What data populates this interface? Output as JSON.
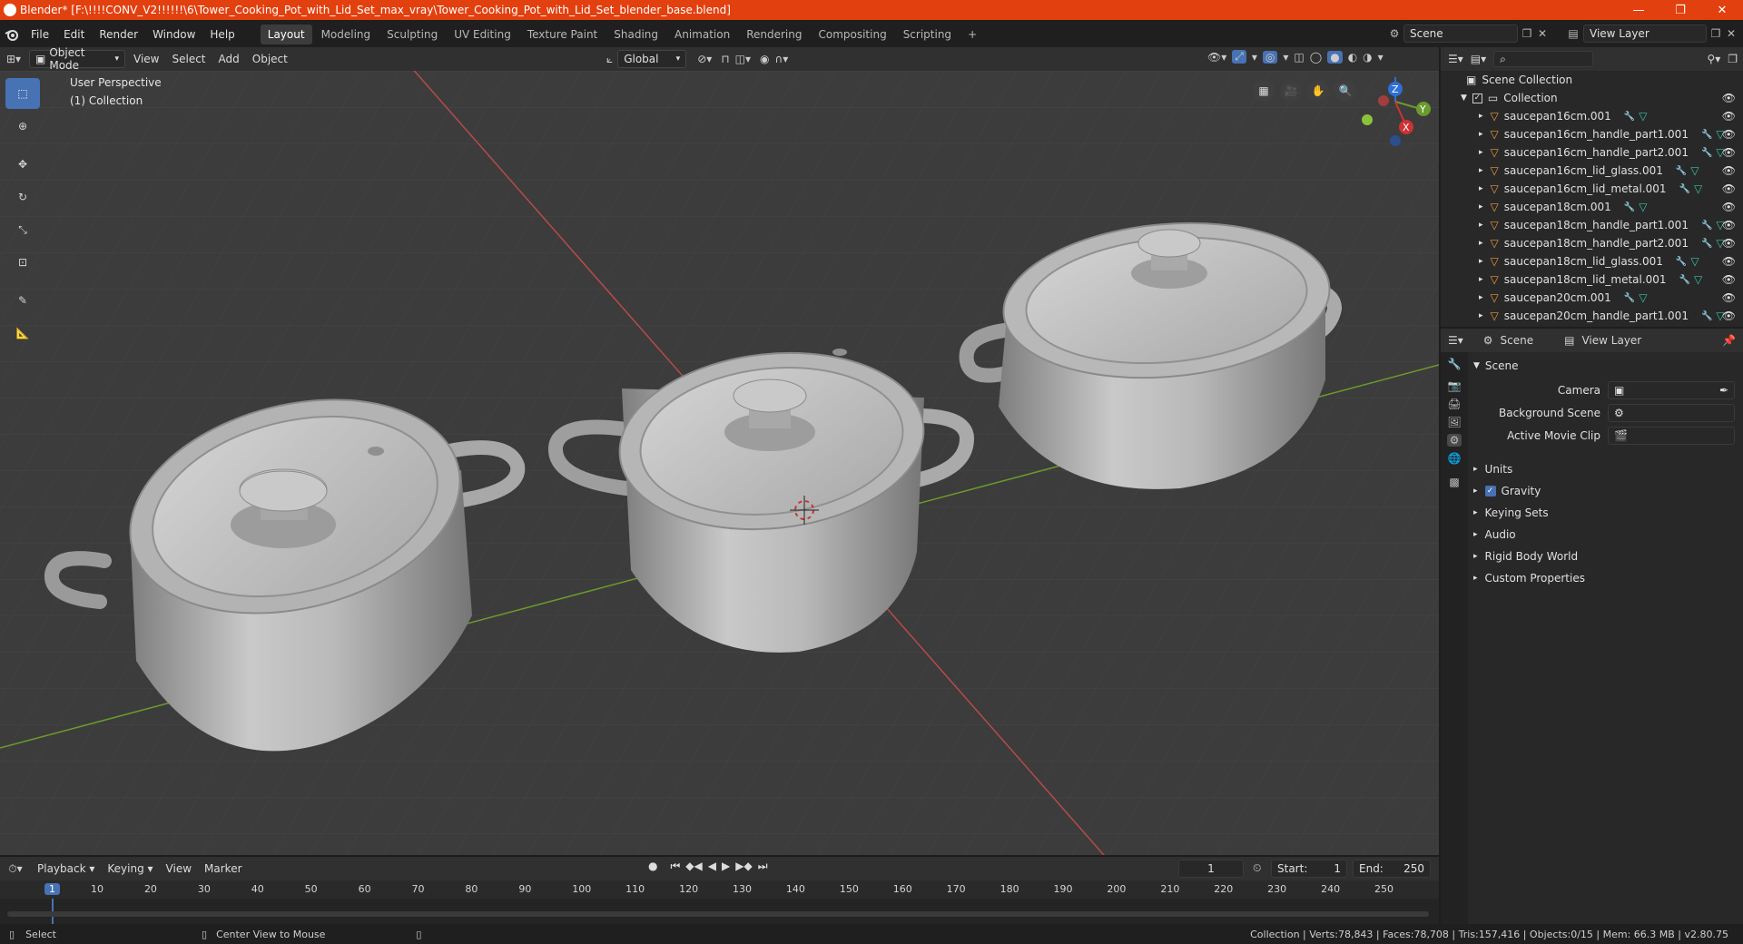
{
  "window": {
    "title": "Blender* [F:\\!!!!CONV_V2!!!!!!\\6\\Tower_Cooking_Pot_with_Lid_Set_max_vray\\Tower_Cooking_Pot_with_Lid_Set_blender_base.blend]",
    "controls": [
      "—",
      "❐",
      "✕"
    ]
  },
  "menubar": {
    "menus": [
      "File",
      "Edit",
      "Render",
      "Window",
      "Help"
    ],
    "workspaces": [
      "Layout",
      "Modeling",
      "Sculpting",
      "UV Editing",
      "Texture Paint",
      "Shading",
      "Animation",
      "Rendering",
      "Compositing",
      "Scripting"
    ],
    "active_workspace": "Layout",
    "add_workspace": "+",
    "scene_name": "Scene",
    "view_layer": "View Layer"
  },
  "viewport_header": {
    "mode": "Object Mode",
    "menus": [
      "View",
      "Select",
      "Add",
      "Object"
    ],
    "transform_orientation": "Global"
  },
  "viewport": {
    "perspective_label": "User Perspective",
    "collection_label": "(1) Collection",
    "gizmo_axes": {
      "x": "X",
      "y": "Y",
      "z": "Z"
    },
    "colors": {
      "background": "#3c3c3c",
      "grid": "#454545",
      "x_axis": "#b84a4a",
      "y_axis": "#6b9a2e",
      "accent": "#4772b3"
    }
  },
  "outliner": {
    "search_placeholder": "",
    "root": "Scene Collection",
    "collection": "Collection",
    "items": [
      "saucepan16cm.001",
      "saucepan16cm_handle_part1.001",
      "saucepan16cm_handle_part2.001",
      "saucepan16cm_lid_glass.001",
      "saucepan16cm_lid_metal.001",
      "saucepan18cm.001",
      "saucepan18cm_handle_part1.001",
      "saucepan18cm_handle_part2.001",
      "saucepan18cm_lid_glass.001",
      "saucepan18cm_lid_metal.001",
      "saucepan20cm.001",
      "saucepan20cm_handle_part1.001"
    ]
  },
  "properties": {
    "breadcrumb_scene": "Scene",
    "breadcrumb_view_layer": "View Layer",
    "panel_title": "Scene",
    "camera_label": "Camera",
    "background_scene_label": "Background Scene",
    "active_movie_clip_label": "Active Movie Clip",
    "subpanels": [
      "Units",
      "Gravity",
      "Keying Sets",
      "Audio",
      "Rigid Body World",
      "Custom Properties"
    ],
    "gravity_checked": true
  },
  "timeline": {
    "menus": [
      "Playback",
      "Keying",
      "View",
      "Marker"
    ],
    "current_frame": "1",
    "start_label": "Start:",
    "start_value": "1",
    "end_label": "End:",
    "end_value": "250",
    "ruler": [
      "1",
      "10",
      "20",
      "30",
      "40",
      "50",
      "60",
      "70",
      "80",
      "90",
      "100",
      "110",
      "120",
      "130",
      "140",
      "150",
      "160",
      "170",
      "180",
      "190",
      "200",
      "210",
      "220",
      "230",
      "240",
      "250"
    ]
  },
  "statusbar": {
    "left_action": "Select",
    "middle_action": "Center View to Mouse",
    "stats": "Collection | Verts:78,843 | Faces:78,708 | Tris:157,416 | Objects:0/15 | Mem: 66.3 MB | v2.80.75"
  }
}
